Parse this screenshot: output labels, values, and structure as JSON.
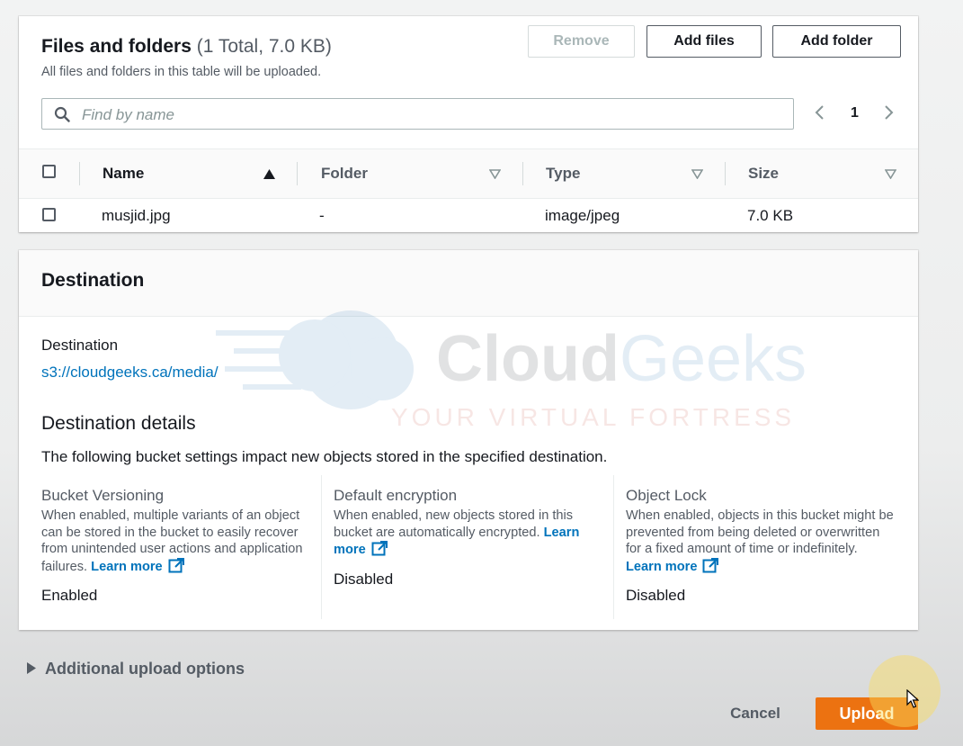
{
  "files": {
    "title": "Files and folders",
    "count": "(1 Total, 7.0 KB)",
    "description": "All files and folders in this table will be uploaded.",
    "remove_label": "Remove",
    "add_files_label": "Add files",
    "add_folder_label": "Add folder",
    "search_placeholder": "Find by name",
    "page_number": "1",
    "columns": [
      "Name",
      "Folder",
      "Type",
      "Size"
    ],
    "rows": [
      {
        "name": "musjid.jpg",
        "folder": "-",
        "type": "image/jpeg",
        "size": "7.0 KB"
      }
    ]
  },
  "destination": {
    "title": "Destination",
    "label": "Destination",
    "path": "s3://cloudgeeks.ca/media/",
    "details_title": "Destination details",
    "details_desc": "The following bucket settings impact new objects stored in the specified destination.",
    "versioning": {
      "title": "Bucket Versioning",
      "text": "When enabled, multiple variants of an object can be stored in the bucket to easily recover from unintended user actions and application failures.",
      "link": "Learn more",
      "value": "Enabled"
    },
    "encryption": {
      "title": "Default encryption",
      "text": "When enabled, new objects stored in this bucket are automatically encrypted.",
      "link_part1": "Learn",
      "link_part2": "more",
      "value": "Disabled"
    },
    "object_lock": {
      "title": "Object Lock",
      "text": "When enabled, objects in this bucket might be prevented from being deleted or overwritten for a fixed amount of time or indefinitely.",
      "link": "Learn more",
      "value": "Disabled"
    }
  },
  "watermark": {
    "brand_part1": "Cloud",
    "brand_part2": "Geeks",
    "tagline": "YOUR VIRTUAL FORTRESS"
  },
  "footer": {
    "additional_label": "Additional upload options",
    "cancel_label": "Cancel",
    "upload_label": "Upload"
  },
  "colors": {
    "link": "#0073bb",
    "upload_button": "#ec7211",
    "text_primary": "#16191f",
    "text_secondary": "#545b64"
  }
}
